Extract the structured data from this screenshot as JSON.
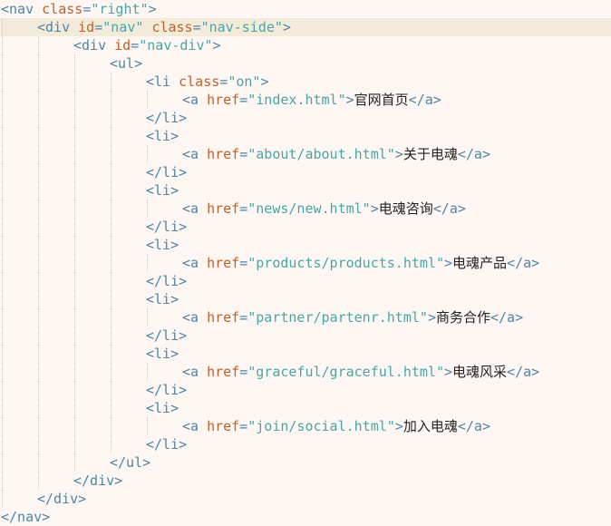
{
  "code_view": {
    "lines": [
      {
        "indent": 0,
        "guides": 0,
        "tokens": [
          {
            "t": "tag",
            "v": "<nav "
          },
          {
            "t": "attr",
            "v": "class"
          },
          {
            "t": "tag",
            "v": "="
          },
          {
            "t": "val",
            "v": "\"right\""
          },
          {
            "t": "tag",
            "v": ">"
          }
        ]
      },
      {
        "indent": 1,
        "guides": 1,
        "current": true,
        "tokens": [
          {
            "t": "tag",
            "v": "<div "
          },
          {
            "t": "attr",
            "v": "id"
          },
          {
            "t": "tag",
            "v": "="
          },
          {
            "t": "val",
            "v": "\"nav\""
          },
          {
            "t": "tag",
            "v": " "
          },
          {
            "t": "attr",
            "v": "class"
          },
          {
            "t": "tag",
            "v": "="
          },
          {
            "t": "val",
            "v": "\"nav-side\""
          },
          {
            "t": "tag",
            "v": ">"
          }
        ]
      },
      {
        "indent": 2,
        "guides": 2,
        "tokens": [
          {
            "t": "tag",
            "v": "<div "
          },
          {
            "t": "attr",
            "v": "id"
          },
          {
            "t": "tag",
            "v": "="
          },
          {
            "t": "val",
            "v": "\"nav-div\""
          },
          {
            "t": "tag",
            "v": ">"
          }
        ]
      },
      {
        "indent": 3,
        "guides": 3,
        "tokens": [
          {
            "t": "tag",
            "v": "<ul>"
          }
        ]
      },
      {
        "indent": 4,
        "guides": 4,
        "tokens": [
          {
            "t": "tag",
            "v": "<li "
          },
          {
            "t": "attr",
            "v": "class"
          },
          {
            "t": "tag",
            "v": "="
          },
          {
            "t": "val",
            "v": "\"on\""
          },
          {
            "t": "tag",
            "v": ">"
          }
        ]
      },
      {
        "indent": 5,
        "guides": 5,
        "tokens": [
          {
            "t": "tag",
            "v": "<a "
          },
          {
            "t": "attr",
            "v": "href"
          },
          {
            "t": "tag",
            "v": "="
          },
          {
            "t": "val",
            "v": "\"index.html\""
          },
          {
            "t": "tag",
            "v": ">"
          },
          {
            "t": "txt",
            "v": "官网首页"
          },
          {
            "t": "tag",
            "v": "</a>"
          }
        ]
      },
      {
        "indent": 4,
        "guides": 4,
        "tokens": [
          {
            "t": "tag",
            "v": "</li>"
          }
        ]
      },
      {
        "indent": 4,
        "guides": 4,
        "tokens": [
          {
            "t": "tag",
            "v": "<li>"
          }
        ]
      },
      {
        "indent": 5,
        "guides": 5,
        "tokens": [
          {
            "t": "tag",
            "v": "<a "
          },
          {
            "t": "attr",
            "v": "href"
          },
          {
            "t": "tag",
            "v": "="
          },
          {
            "t": "val",
            "v": "\"about/about.html\""
          },
          {
            "t": "tag",
            "v": ">"
          },
          {
            "t": "txt",
            "v": "关于电魂"
          },
          {
            "t": "tag",
            "v": "</a>"
          }
        ]
      },
      {
        "indent": 4,
        "guides": 4,
        "tokens": [
          {
            "t": "tag",
            "v": "</li>"
          }
        ]
      },
      {
        "indent": 4,
        "guides": 4,
        "tokens": [
          {
            "t": "tag",
            "v": "<li>"
          }
        ]
      },
      {
        "indent": 5,
        "guides": 5,
        "tokens": [
          {
            "t": "tag",
            "v": "<a "
          },
          {
            "t": "attr",
            "v": "href"
          },
          {
            "t": "tag",
            "v": "="
          },
          {
            "t": "val",
            "v": "\"news/new.html\""
          },
          {
            "t": "tag",
            "v": ">"
          },
          {
            "t": "txt",
            "v": "电魂咨询"
          },
          {
            "t": "tag",
            "v": "</a>"
          }
        ]
      },
      {
        "indent": 4,
        "guides": 4,
        "tokens": [
          {
            "t": "tag",
            "v": "</li>"
          }
        ]
      },
      {
        "indent": 4,
        "guides": 4,
        "tokens": [
          {
            "t": "tag",
            "v": "<li>"
          }
        ]
      },
      {
        "indent": 5,
        "guides": 5,
        "tokens": [
          {
            "t": "tag",
            "v": "<a "
          },
          {
            "t": "attr",
            "v": "href"
          },
          {
            "t": "tag",
            "v": "="
          },
          {
            "t": "val",
            "v": "\"products/products.html\""
          },
          {
            "t": "tag",
            "v": ">"
          },
          {
            "t": "txt",
            "v": "电魂产品"
          },
          {
            "t": "tag",
            "v": "</a>"
          }
        ]
      },
      {
        "indent": 4,
        "guides": 4,
        "tokens": [
          {
            "t": "tag",
            "v": "</li>"
          }
        ]
      },
      {
        "indent": 4,
        "guides": 4,
        "tokens": [
          {
            "t": "tag",
            "v": "<li>"
          }
        ]
      },
      {
        "indent": 5,
        "guides": 5,
        "tokens": [
          {
            "t": "tag",
            "v": "<a "
          },
          {
            "t": "attr",
            "v": "href"
          },
          {
            "t": "tag",
            "v": "="
          },
          {
            "t": "val",
            "v": "\"partner/partenr.html\""
          },
          {
            "t": "tag",
            "v": ">"
          },
          {
            "t": "txt",
            "v": "商务合作"
          },
          {
            "t": "tag",
            "v": "</a>"
          }
        ]
      },
      {
        "indent": 4,
        "guides": 4,
        "tokens": [
          {
            "t": "tag",
            "v": "</li>"
          }
        ]
      },
      {
        "indent": 4,
        "guides": 4,
        "tokens": [
          {
            "t": "tag",
            "v": "<li>"
          }
        ]
      },
      {
        "indent": 5,
        "guides": 5,
        "tokens": [
          {
            "t": "tag",
            "v": "<a "
          },
          {
            "t": "attr",
            "v": "href"
          },
          {
            "t": "tag",
            "v": "="
          },
          {
            "t": "val",
            "v": "\"graceful/graceful.html\""
          },
          {
            "t": "tag",
            "v": ">"
          },
          {
            "t": "txt",
            "v": "电魂风采"
          },
          {
            "t": "tag",
            "v": "</a>"
          }
        ]
      },
      {
        "indent": 4,
        "guides": 4,
        "tokens": [
          {
            "t": "tag",
            "v": "</li>"
          }
        ]
      },
      {
        "indent": 4,
        "guides": 4,
        "tokens": [
          {
            "t": "tag",
            "v": "<li>"
          }
        ]
      },
      {
        "indent": 5,
        "guides": 5,
        "tokens": [
          {
            "t": "tag",
            "v": "<a "
          },
          {
            "t": "attr",
            "v": "href"
          },
          {
            "t": "tag",
            "v": "="
          },
          {
            "t": "val",
            "v": "\"join/social.html\""
          },
          {
            "t": "tag",
            "v": ">"
          },
          {
            "t": "txt",
            "v": "加入电魂"
          },
          {
            "t": "tag",
            "v": "</a>"
          }
        ]
      },
      {
        "indent": 4,
        "guides": 4,
        "tokens": [
          {
            "t": "tag",
            "v": "</li>"
          }
        ]
      },
      {
        "indent": 3,
        "guides": 3,
        "tokens": [
          {
            "t": "tag",
            "v": "</ul>"
          }
        ]
      },
      {
        "indent": 2,
        "guides": 2,
        "tokens": [
          {
            "t": "tag",
            "v": "</div>"
          }
        ]
      },
      {
        "indent": 1,
        "guides": 1,
        "tokens": [
          {
            "t": "tag",
            "v": "</div>"
          }
        ]
      },
      {
        "indent": 0,
        "guides": 0,
        "tokens": [
          {
            "t": "tag",
            "v": "</nav>"
          }
        ]
      }
    ]
  }
}
